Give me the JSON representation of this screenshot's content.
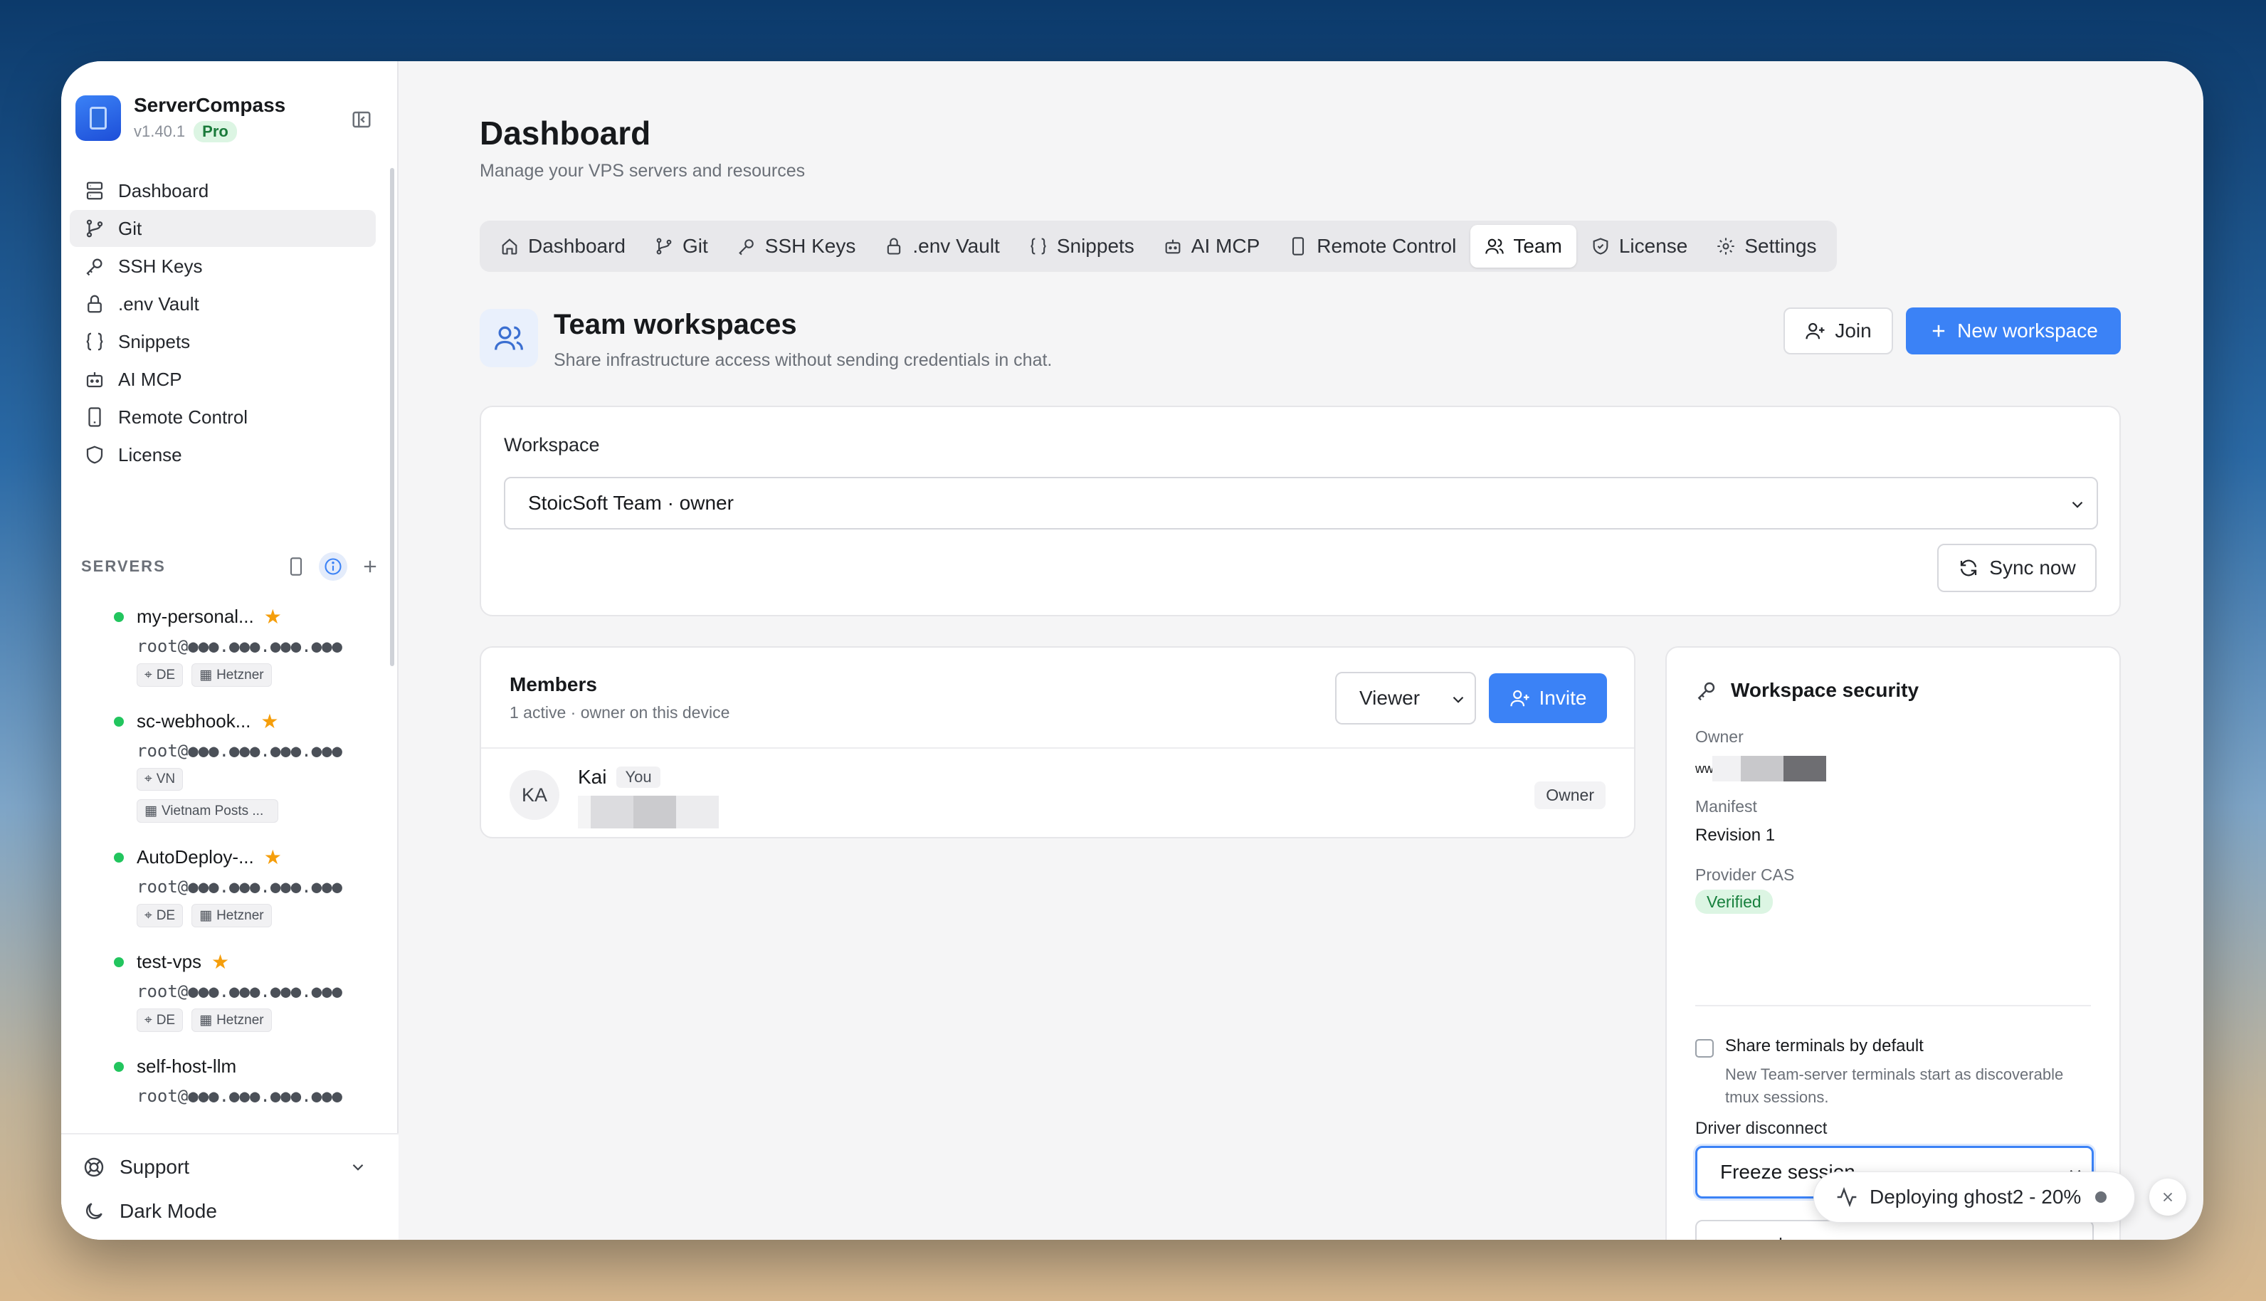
{
  "app": {
    "name": "ServerCompass",
    "version": "v1.40.1",
    "plan_badge": "Pro"
  },
  "sidebar": {
    "nav": [
      {
        "label": "Dashboard",
        "icon": "database-icon"
      },
      {
        "label": "Git",
        "icon": "git-branch-icon"
      },
      {
        "label": "SSH Keys",
        "icon": "key-icon"
      },
      {
        "label": ".env Vault",
        "icon": "lock-icon"
      },
      {
        "label": "Snippets",
        "icon": "braces-icon"
      },
      {
        "label": "AI MCP",
        "icon": "bot-icon"
      },
      {
        "label": "Remote Control",
        "icon": "phone-icon"
      },
      {
        "label": "License",
        "icon": "shield-icon"
      }
    ],
    "active_index": 1,
    "servers_heading": "SERVERS",
    "servers": [
      {
        "name": "my-personal...",
        "addr": "root@●●●.●●●.●●●.●●●",
        "tags": [
          "DE",
          "Hetzner"
        ],
        "starred": true,
        "status": "online"
      },
      {
        "name": "sc-webhook...",
        "addr": "root@●●●.●●●.●●●.●●●",
        "tags": [
          "VN",
          "Vietnam Posts ..."
        ],
        "starred": true,
        "status": "online"
      },
      {
        "name": "AutoDeploy-...",
        "addr": "root@●●●.●●●.●●●.●●●",
        "tags": [
          "DE",
          "Hetzner"
        ],
        "starred": true,
        "status": "online"
      },
      {
        "name": "test-vps",
        "addr": "root@●●●.●●●.●●●.●●●",
        "tags": [
          "DE",
          "Hetzner"
        ],
        "starred": true,
        "status": "online"
      },
      {
        "name": "self-host-llm",
        "addr": "root@●●●.●●●.●●●.●●●",
        "tags": [],
        "starred": false,
        "status": "online"
      }
    ],
    "support_label": "Support",
    "dark_mode_label": "Dark Mode"
  },
  "page": {
    "title": "Dashboard",
    "subtitle": "Manage your VPS servers and resources"
  },
  "tabs": [
    {
      "label": "Dashboard",
      "icon": "home-icon"
    },
    {
      "label": "Git",
      "icon": "git-branch-icon"
    },
    {
      "label": "SSH Keys",
      "icon": "key-icon"
    },
    {
      "label": ".env Vault",
      "icon": "lock-icon"
    },
    {
      "label": "Snippets",
      "icon": "braces-icon"
    },
    {
      "label": "AI MCP",
      "icon": "bot-icon"
    },
    {
      "label": "Remote Control",
      "icon": "phone-icon"
    },
    {
      "label": "Team",
      "icon": "users-icon"
    },
    {
      "label": "License",
      "icon": "shield-check-icon"
    },
    {
      "label": "Settings",
      "icon": "gear-icon"
    }
  ],
  "active_tab": 7,
  "team": {
    "title": "Team workspaces",
    "subtitle": "Share infrastructure access without sending credentials in chat.",
    "join_label": "Join",
    "new_workspace_label": "New workspace",
    "workspace_label": "Workspace",
    "workspace_selected": "StoicSoft Team · owner",
    "sync_label": "Sync now"
  },
  "members": {
    "title": "Members",
    "subtitle": "1 active · owner on this device",
    "role_selected": "Viewer",
    "invite_label": "Invite",
    "list": [
      {
        "initials": "KA",
        "name": "Kai",
        "you_badge": "You",
        "role": "Owner"
      }
    ]
  },
  "security": {
    "title": "Workspace security",
    "owner_label": "Owner",
    "owner_value": "ww",
    "manifest_label": "Manifest",
    "manifest_value": "Revision 1",
    "provider_label": "Provider CAS",
    "provider_value": "Verified",
    "share_terminals_label": "Share terminals by default",
    "share_terminals_checked": false,
    "share_terminals_help": "New Team-server terminals start as discoverable tmux sessions.",
    "driver_label": "Driver disconnect",
    "driver_selected": "Freeze session"
  },
  "toast": {
    "text": "Deploying ghost2 - 20%"
  },
  "colors": {
    "accent": "#3b82f6",
    "online": "#22c55e",
    "star": "#f59e0b",
    "verified_bg": "#dcf5e3"
  }
}
